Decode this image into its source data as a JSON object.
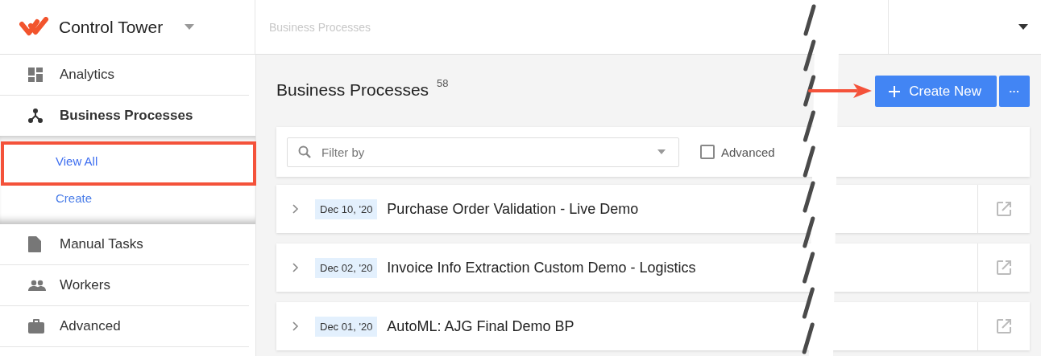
{
  "app": {
    "title": "Control Tower"
  },
  "breadcrumb": "Business Processes",
  "sidebar": {
    "items": [
      {
        "label": "Analytics",
        "selected": false
      },
      {
        "label": "Business Processes",
        "selected": true,
        "children": [
          {
            "label": "View All",
            "selected": true
          },
          {
            "label": "Create",
            "selected": false
          }
        ]
      },
      {
        "label": "Manual Tasks",
        "selected": false
      },
      {
        "label": "Workers",
        "selected": false
      },
      {
        "label": "Advanced",
        "selected": false
      }
    ]
  },
  "page": {
    "title": "Business Processes",
    "count": "58",
    "create_button": "Create New",
    "more_button": "···"
  },
  "filter": {
    "placeholder": "Filter by",
    "advanced": {
      "label": "Advanced",
      "checked": false
    }
  },
  "processes": [
    {
      "date": "Dec 10, '20",
      "name": "Purchase Order Validation - Live Demo",
      "expanded": false
    },
    {
      "date": "Dec 02, '20",
      "name": "Invoice Info Extraction Custom Demo - Logistics",
      "expanded": false
    },
    {
      "date": "Dec 01, '20",
      "name": "AutoML: AJG Final Demo BP",
      "expanded": false
    }
  ]
}
